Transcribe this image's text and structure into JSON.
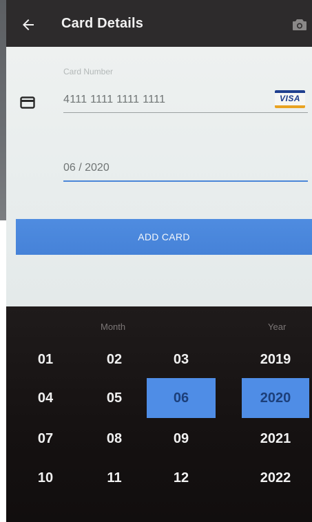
{
  "header": {
    "title": "Card Details"
  },
  "form": {
    "card_number_label": "Card Number",
    "card_number": "4111 1111 1111 1111",
    "card_brand": "VISA",
    "expiry": "06 / 2020",
    "add_button": "ADD CARD"
  },
  "picker": {
    "month_header": "Month",
    "year_header": "Year",
    "months": [
      "01",
      "02",
      "03",
      "04",
      "05",
      "06",
      "07",
      "08",
      "09",
      "10",
      "11",
      "12"
    ],
    "selected_month": "06",
    "years": [
      "2019",
      "2020",
      "2021",
      "2022"
    ],
    "selected_year": "2020"
  },
  "colors": {
    "topbar": "#2d2b2c",
    "accent": "#4f8de6",
    "picker_bg": "#151111"
  }
}
